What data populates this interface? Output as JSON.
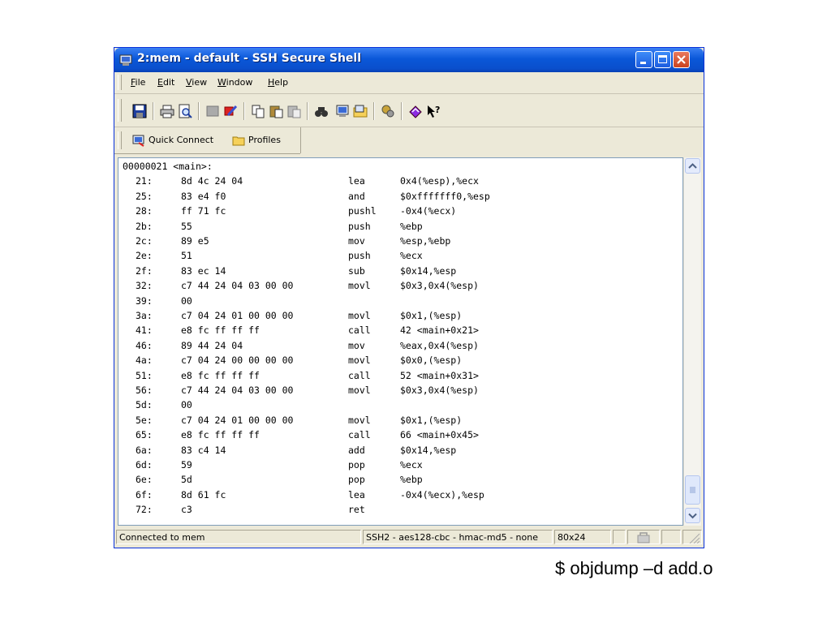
{
  "window": {
    "title": "2:mem - default - SSH Secure Shell"
  },
  "menu": [
    {
      "label": "File",
      "mnemonic": "F",
      "rest": "ile"
    },
    {
      "label": "Edit",
      "mnemonic": "E",
      "rest": "dit"
    },
    {
      "label": "View",
      "mnemonic": "V",
      "rest": "iew"
    },
    {
      "label": "Window",
      "mnemonic": "W",
      "rest": "indow"
    },
    {
      "label": "Help",
      "mnemonic": "H",
      "rest": "elp"
    }
  ],
  "toolbar_icons": [
    "save-icon",
    "print-icon",
    "print-preview-icon",
    "disconnect-icon",
    "quick-disconnect-icon",
    "copy-icon",
    "paste-icon",
    "paste-special-icon",
    "find-icon",
    "new-terminal-icon",
    "new-file-transfer-icon",
    "settings-icon",
    "help-icon",
    "whats-this-icon"
  ],
  "profiles": {
    "quick_connect": "Quick Connect",
    "profiles": "Profiles"
  },
  "terminal": {
    "header": "00000021 <main>:",
    "lines": [
      {
        "addr": "21:",
        "bytes": "8d 4c 24 04",
        "op": "lea",
        "args": "0x4(%esp),%ecx"
      },
      {
        "addr": "25:",
        "bytes": "83 e4 f0",
        "op": "and",
        "args": "$0xfffffff0,%esp"
      },
      {
        "addr": "28:",
        "bytes": "ff 71 fc",
        "op": "pushl",
        "args": "-0x4(%ecx)"
      },
      {
        "addr": "2b:",
        "bytes": "55",
        "op": "push",
        "args": "%ebp"
      },
      {
        "addr": "2c:",
        "bytes": "89 e5",
        "op": "mov",
        "args": "%esp,%ebp"
      },
      {
        "addr": "2e:",
        "bytes": "51",
        "op": "push",
        "args": "%ecx"
      },
      {
        "addr": "2f:",
        "bytes": "83 ec 14",
        "op": "sub",
        "args": "$0x14,%esp"
      },
      {
        "addr": "32:",
        "bytes": "c7 44 24 04 03 00 00",
        "op": "movl",
        "args": "$0x3,0x4(%esp)"
      },
      {
        "addr": "39:",
        "bytes": "00",
        "op": "",
        "args": ""
      },
      {
        "addr": "3a:",
        "bytes": "c7 04 24 01 00 00 00",
        "op": "movl",
        "args": "$0x1,(%esp)"
      },
      {
        "addr": "41:",
        "bytes": "e8 fc ff ff ff",
        "op": "call",
        "args": "42 <main+0x21>"
      },
      {
        "addr": "46:",
        "bytes": "89 44 24 04",
        "op": "mov",
        "args": "%eax,0x4(%esp)"
      },
      {
        "addr": "4a:",
        "bytes": "c7 04 24 00 00 00 00",
        "op": "movl",
        "args": "$0x0,(%esp)"
      },
      {
        "addr": "51:",
        "bytes": "e8 fc ff ff ff",
        "op": "call",
        "args": "52 <main+0x31>"
      },
      {
        "addr": "56:",
        "bytes": "c7 44 24 04 03 00 00",
        "op": "movl",
        "args": "$0x3,0x4(%esp)"
      },
      {
        "addr": "5d:",
        "bytes": "00",
        "op": "",
        "args": ""
      },
      {
        "addr": "5e:",
        "bytes": "c7 04 24 01 00 00 00",
        "op": "movl",
        "args": "$0x1,(%esp)"
      },
      {
        "addr": "65:",
        "bytes": "e8 fc ff ff ff",
        "op": "call",
        "args": "66 <main+0x45>"
      },
      {
        "addr": "6a:",
        "bytes": "83 c4 14",
        "op": "add",
        "args": "$0x14,%esp"
      },
      {
        "addr": "6d:",
        "bytes": "59",
        "op": "pop",
        "args": "%ecx"
      },
      {
        "addr": "6e:",
        "bytes": "5d",
        "op": "pop",
        "args": "%ebp"
      },
      {
        "addr": "6f:",
        "bytes": "8d 61 fc",
        "op": "lea",
        "args": "-0x4(%ecx),%esp"
      },
      {
        "addr": "72:",
        "bytes": "c3",
        "op": "ret",
        "args": ""
      }
    ]
  },
  "statusbar": {
    "connection": "Connected to mem",
    "encryption": "SSH2 - aes128-cbc - hmac-md5 - none",
    "size": "80x24"
  },
  "caption": "$ objdump –d add.o",
  "colors": {
    "titlebar": "#0a57d8",
    "chrome": "#ece9d8",
    "terminal_bg": "#ffffff"
  }
}
